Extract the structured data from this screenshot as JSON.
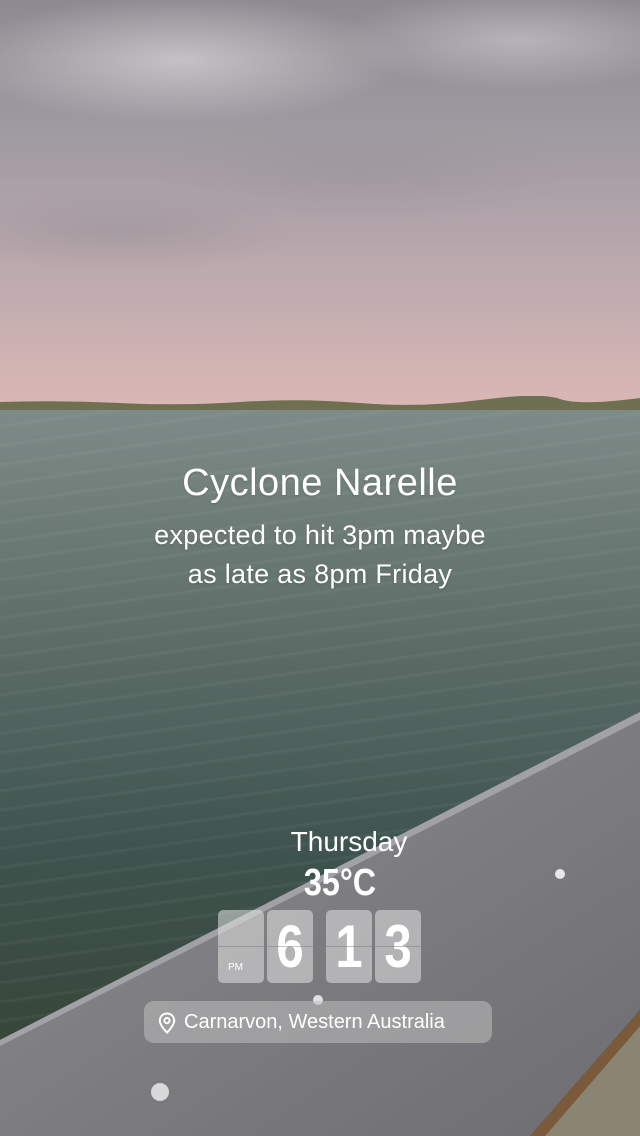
{
  "story": {
    "title": "Cyclone Narelle",
    "line1": "expected to hit 3pm maybe",
    "line2": "as late as 8pm Friday"
  },
  "weather_sticker": {
    "day": "Thursday",
    "temperature": "35°C"
  },
  "time_sticker": {
    "ampm": "PM",
    "hour": "6",
    "minute_tens": "1",
    "minute_ones": "3"
  },
  "location_sticker": {
    "icon": "location-pin-icon",
    "label": "Carnarvon, Western Australia"
  }
}
